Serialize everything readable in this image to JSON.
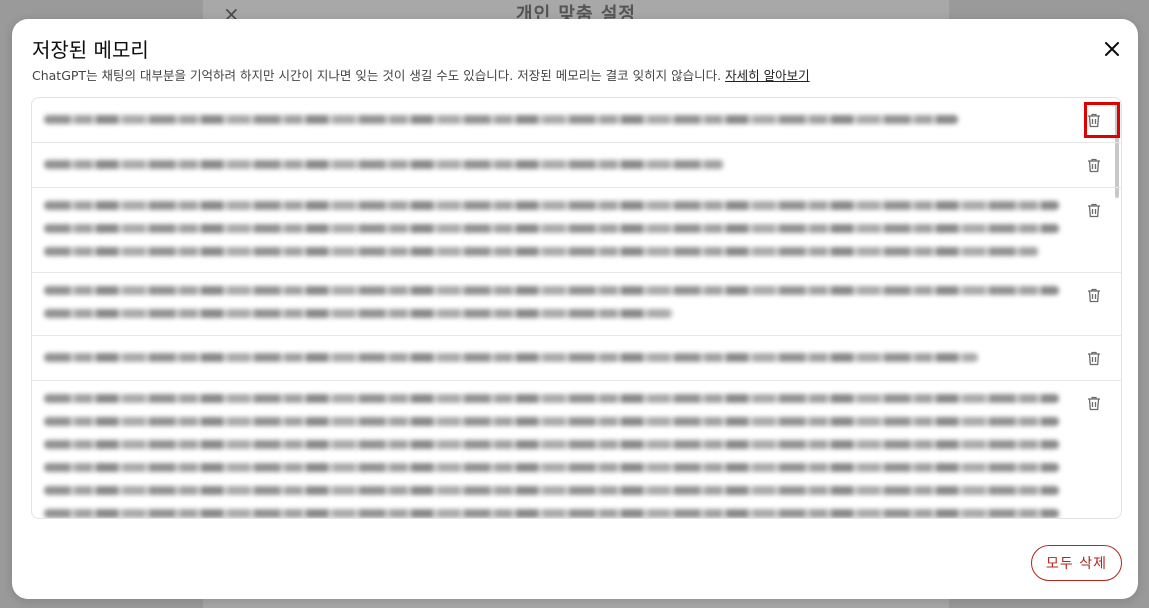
{
  "background_dialog": {
    "title": "개인 맞춤 설정",
    "close_icon": "×"
  },
  "modal": {
    "title": "저장된 메모리",
    "subtitle": "ChatGPT는 채팅의 대부분을 기억하려 하지만 시간이 지나면 잊는 것이 생길 수도 있습니다. 저장된 메모리는 결코 잊히지 않습니다.",
    "learn_more_link": "자세히 알아보기",
    "close_icon": "close-icon",
    "delete_all_label": "모두 삭제"
  },
  "memories": [
    {
      "lines": 1,
      "blurred": true
    },
    {
      "lines": 1,
      "blurred": true
    },
    {
      "lines": 3,
      "blurred": true
    },
    {
      "lines": 2,
      "blurred": true
    },
    {
      "lines": 1,
      "blurred": true
    },
    {
      "lines": 6,
      "blurred": true
    }
  ],
  "colors": {
    "danger": "#b3261e",
    "highlight": "#e00000"
  }
}
